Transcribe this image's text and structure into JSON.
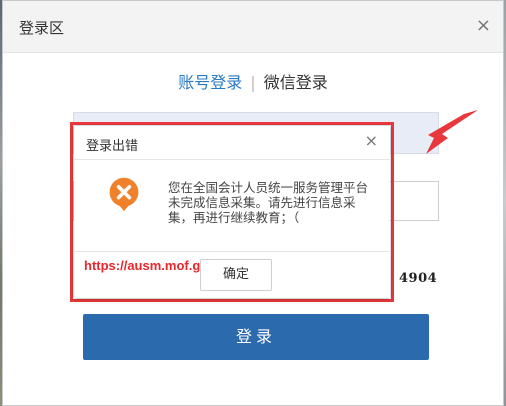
{
  "login_window": {
    "title": "登录区",
    "close_glyph": "×",
    "tabs": {
      "account": "账号登录",
      "separator": "|",
      "wechat": "微信登录"
    },
    "captcha_text": "4904",
    "login_button": "登录"
  },
  "error_dialog": {
    "title": "登录出错",
    "close_glyph": "×",
    "message": "您在全国会计人员统一服务管理平台未完成信息采集。请先进行信息采集，再进行继续教育；（",
    "message_tail": "）",
    "link_text": "https://ausm.mof.gov.cn",
    "ok_button": "确定",
    "icon": "error-x-icon"
  },
  "colors": {
    "accent_blue": "#2a79c3",
    "button_blue": "#2a6aad",
    "error_orange": "#f0802a",
    "annotation_red": "#e8383d"
  }
}
